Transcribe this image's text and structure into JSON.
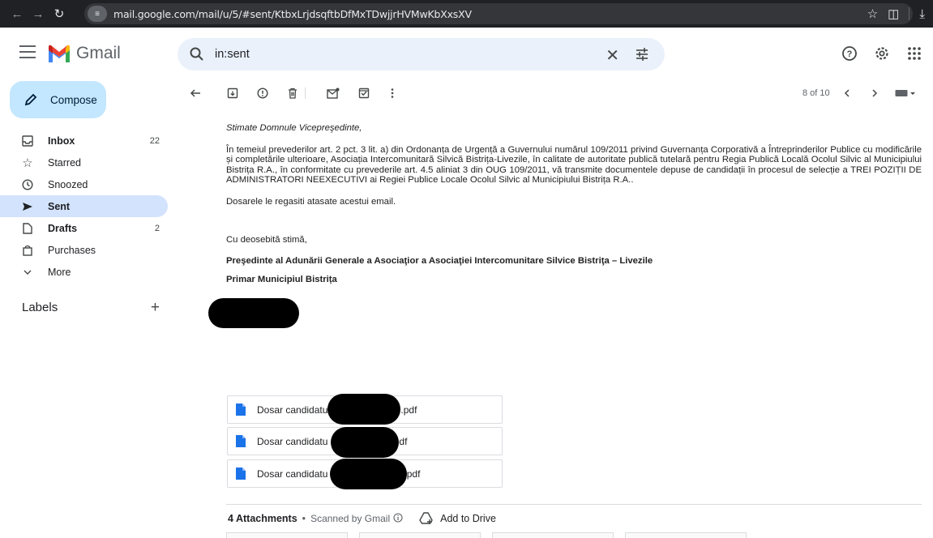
{
  "browser": {
    "url": "mail.google.com/mail/u/5/#sent/KtbxLrjdsqftbDfMxTDwjjrHVMwKbXxsXV"
  },
  "app": {
    "name": "Gmail",
    "search_value": "in:sent"
  },
  "sidebar": {
    "compose_label": "Compose",
    "items": [
      {
        "label": "Inbox",
        "count": "22",
        "icon": "inbox-icon"
      },
      {
        "label": "Starred",
        "count": "",
        "icon": "star-icon"
      },
      {
        "label": "Snoozed",
        "count": "",
        "icon": "clock-icon"
      },
      {
        "label": "Sent",
        "count": "",
        "icon": "send-icon"
      },
      {
        "label": "Drafts",
        "count": "2",
        "icon": "draft-icon"
      },
      {
        "label": "Purchases",
        "count": "",
        "icon": "bag-icon"
      },
      {
        "label": "More",
        "count": "",
        "icon": "chevron-down-icon"
      }
    ],
    "labels_title": "Labels"
  },
  "toolbar": {
    "pager": "8 of 10"
  },
  "email": {
    "greeting": "Stimate Domnule Vicepreşedinte,",
    "paragraph1": "În temeiul prevederilor art. 2 pct. 3 lit. a) din Ordonanța de Urgență a Guvernului numărul 109/2011 privind Guvernanța Corporativă a Întreprinderilor Publice cu modificările și completările ulterioare, Asociația Intercomunitară Silvică Bistrița-Livezile, în calitate de autoritate publică tutelară pentru Regia Publică Locală Ocolul Silvic al Municipiului Bistrița R.A., în conformitate cu prevederile art. 4.5 aliniat 3 din OUG 109/2011, vă transmite documentele depuse de candidații în procesul de selecție a TREI POZIȚII DE ADMINISTRATORI NEEXECUTIVI ai Regiei Publice Locale Ocolul Silvic al Municipiului Bistrița R.A..",
    "paragraph2": "Dosarele le regasiti atasate acestui email.",
    "closing": "Cu deosebită stimă,",
    "signature_title": "Preşedinte al Adunării Generale a Asociaţior a Asociaţiei Intercomunitare Silvice Bistriţa – Livezile",
    "signature_role": "Primar Municipiul Bistrița"
  },
  "attachments": {
    "files": [
      {
        "prefix": "Dosar candidatu",
        "suffix": ".pdf"
      },
      {
        "prefix": "Dosar candidatu",
        "suffix": "df"
      },
      {
        "prefix": "Dosar candidatu",
        "suffix": ".pdf"
      }
    ],
    "count_label": "4 Attachments",
    "dot": "•",
    "scanned_label": "Scanned by Gmail",
    "add_to_drive": "Add to Drive"
  },
  "colors": {
    "compose_bg": "#c2e7ff",
    "active_nav_bg": "#d3e3fd",
    "search_bg": "#eaf1fb",
    "pdf_icon": "#1a73e8"
  }
}
